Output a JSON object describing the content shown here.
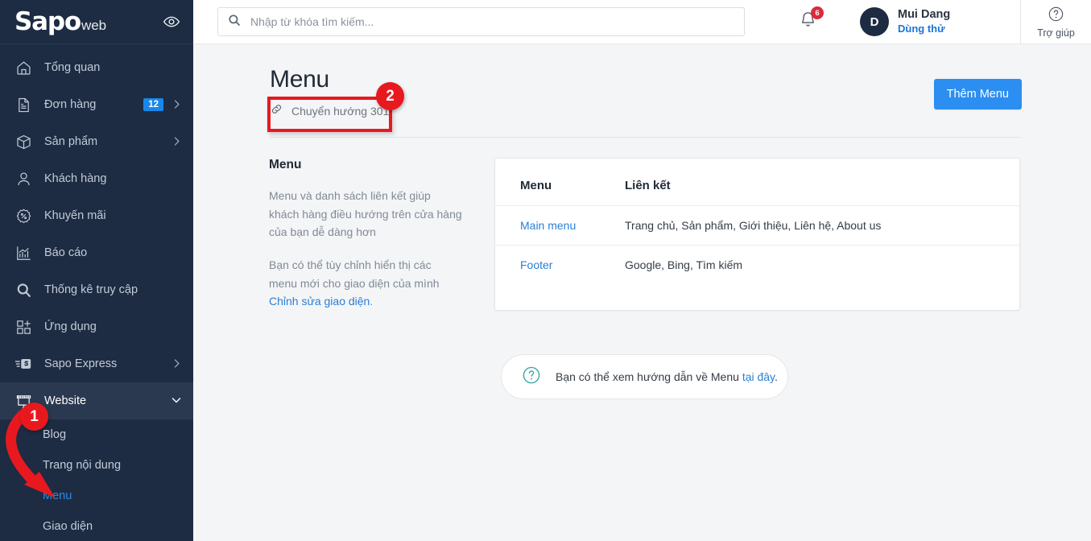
{
  "sidebar": {
    "brand": {
      "logo_main": "Sapo",
      "logo_sub": "web",
      "eye_icon": "eye-icon"
    },
    "items": [
      {
        "label": "Tổng quan",
        "icon": "home-icon",
        "badge": null,
        "chevron": false,
        "active": false
      },
      {
        "label": "Đơn hàng",
        "icon": "document-icon",
        "badge": "12",
        "chevron": true,
        "active": false
      },
      {
        "label": "Sản phẩm",
        "icon": "box-icon",
        "badge": null,
        "chevron": true,
        "active": false
      },
      {
        "label": "Khách hàng",
        "icon": "user-icon",
        "badge": null,
        "chevron": false,
        "active": false
      },
      {
        "label": "Khuyến mãi",
        "icon": "percent-badge-icon",
        "badge": null,
        "chevron": false,
        "active": false
      },
      {
        "label": "Báo cáo",
        "icon": "bar-chart-icon",
        "badge": null,
        "chevron": false,
        "active": false
      },
      {
        "label": "Thống kê truy cập",
        "icon": "magnifier-icon",
        "badge": null,
        "chevron": false,
        "active": false
      },
      {
        "label": "Ứng dụng",
        "icon": "apps-add-icon",
        "badge": null,
        "chevron": false,
        "active": false
      },
      {
        "label": "Sapo Express",
        "icon": "express-s-icon",
        "badge": null,
        "chevron": true,
        "active": false
      },
      {
        "label": "Website",
        "icon": "storefront-icon",
        "badge": null,
        "chevron": true,
        "active": true
      }
    ],
    "sub_items": [
      {
        "label": "Blog",
        "selected": false
      },
      {
        "label": "Trang nội dung",
        "selected": false
      },
      {
        "label": "Menu",
        "selected": true
      },
      {
        "label": "Giao diện",
        "selected": false
      }
    ]
  },
  "topbar": {
    "search": {
      "placeholder": "Nhập từ khóa tìm kiếm...",
      "value": "",
      "icon": "search-icon"
    },
    "notifications": {
      "count": "6",
      "icon": "bell-icon"
    },
    "user": {
      "initial": "D",
      "name": "Mui Dang",
      "plan": "Dùng thử"
    },
    "help": {
      "label": "Trợ giúp",
      "icon": "question-circle-icon"
    }
  },
  "page": {
    "title": "Menu",
    "redirect_link": "Chuyển hướng 301",
    "redirect_icon": "link-icon",
    "add_button": "Thêm Menu"
  },
  "description": {
    "heading": "Menu",
    "paragraph_1": "Menu và danh sách liên kết giúp khách hàng điều hướng trên cửa hàng của bạn dễ dàng hơn",
    "paragraph_2_prefix": "Bạn có thể tùy chỉnh hiển thị các menu mới cho giao diện của mình ",
    "paragraph_2_link": "Chỉnh sửa giao diện",
    "paragraph_2_suffix": "."
  },
  "table": {
    "headers": [
      "Menu",
      "Liên kết"
    ],
    "rows": [
      {
        "name": "Main menu",
        "links": "Trang chủ, Sản phẩm, Giới thiệu, Liên hệ, About us"
      },
      {
        "name": "Footer",
        "links": "Google, Bing, Tìm kiếm"
      }
    ]
  },
  "hint": {
    "icon": "question-circle-icon",
    "text_prefix": "Bạn có thể xem hướng dẫn về Menu ",
    "link": "tại đây",
    "text_suffix": "."
  },
  "annotations": {
    "badge_1": "1",
    "badge_2": "2",
    "color": "#e8191e"
  },
  "colors": {
    "sidebar_bg": "#1d2c43",
    "sidebar_active": "#2a3950",
    "accent_blue": "#2b8ef0",
    "link_blue": "#2b7fd4",
    "badge_red": "#dc2b3c",
    "page_bg": "#f4f5f7"
  }
}
